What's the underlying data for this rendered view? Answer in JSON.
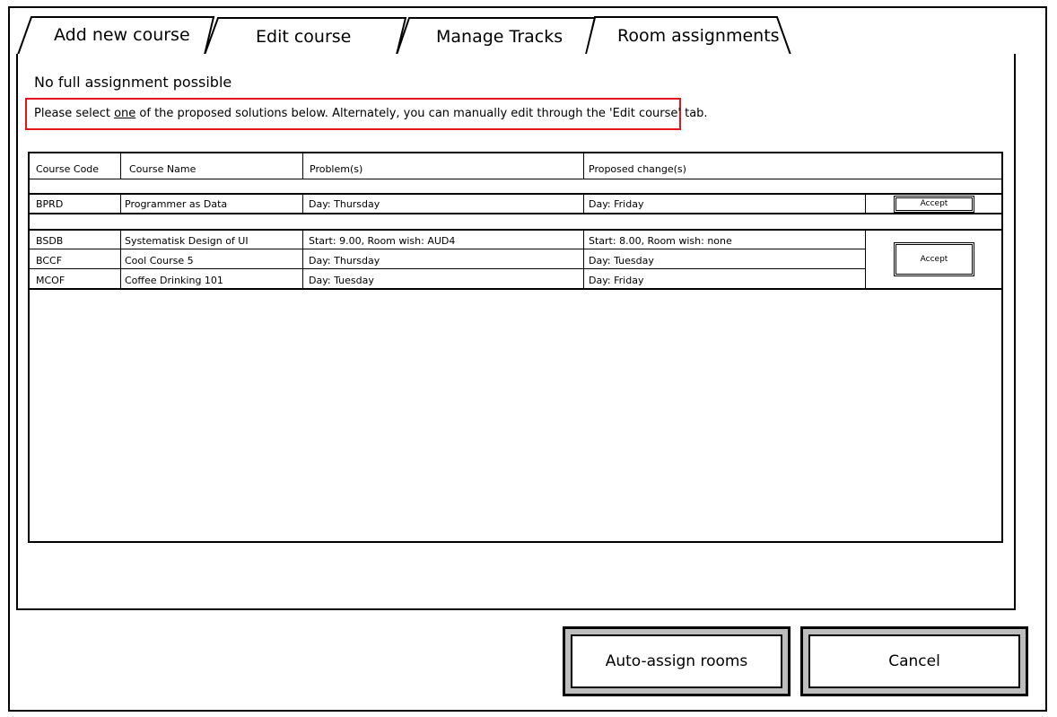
{
  "tabs": [
    {
      "label": "Add new course"
    },
    {
      "label": "Edit course"
    },
    {
      "label": "Manage Tracks"
    },
    {
      "label": "Room assignments",
      "active": true
    }
  ],
  "status": {
    "title": "No full assignment possible",
    "instruction_before": "Please select ",
    "instruction_emphasis": "one",
    "instruction_after": " of the proposed solutions below. Alternately, you can manually edit through the 'Edit course' tab."
  },
  "table": {
    "headers": [
      "Course Code",
      "Course Name",
      "Problem(s)",
      "Proposed change(s)"
    ],
    "groups": [
      {
        "accept_label": "Accept",
        "rows": [
          {
            "code": "BPRD",
            "name": "Programmer as Data",
            "problem": "Day: Thursday",
            "change": "Day: Friday"
          }
        ]
      },
      {
        "accept_label": "Accept",
        "rows": [
          {
            "code": "BSDB",
            "name": "Systematisk Design of UI",
            "problem": "Start: 9.00, Room wish: AUD4",
            "change": "Start: 8.00, Room wish: none"
          },
          {
            "code": "BCCF",
            "name": "Cool Course 5",
            "problem": "Day: Thursday",
            "change": "Day: Tuesday"
          },
          {
            "code": "MCOF",
            "name": "Coffee Drinking 101",
            "problem": "Day: Tuesday",
            "change": "Day: Friday"
          }
        ]
      }
    ]
  },
  "actions": {
    "auto_assign_label": "Auto-assign rooms",
    "cancel_label": "Cancel"
  },
  "colors": {
    "highlight_border": "#e3141b",
    "button_bevel": "#bdbdbd"
  }
}
